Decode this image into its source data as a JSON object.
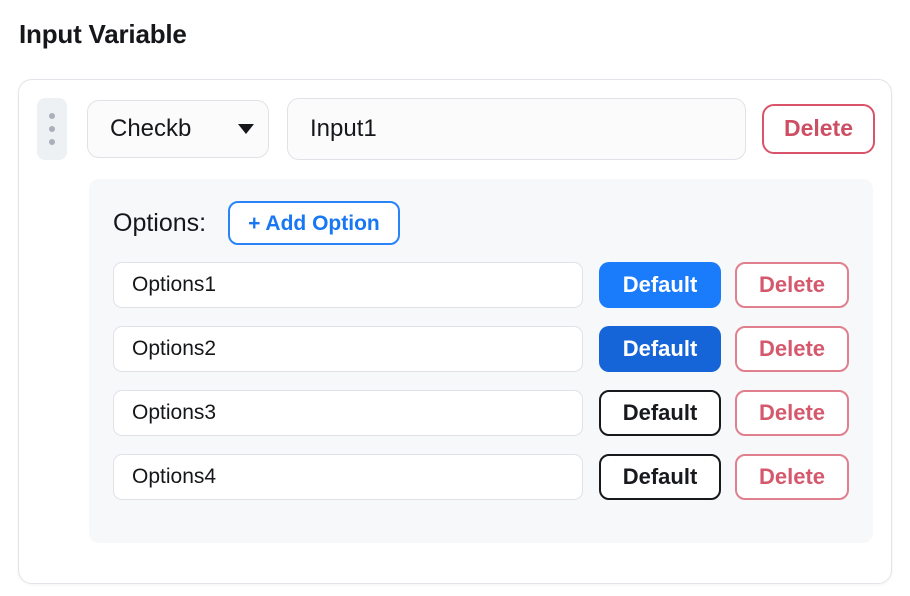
{
  "page": {
    "title": "Input Variable"
  },
  "variable": {
    "drag_handle_icon": "drag-dots-icon",
    "type_select": {
      "value": "Checkb",
      "caret_icon": "chevron-down-icon"
    },
    "name_input": {
      "value": "Input1",
      "placeholder": "Input1"
    },
    "delete_label": "Delete"
  },
  "options_section": {
    "label": "Options:",
    "add_option_label": "+ Add Option",
    "default_label": "Default",
    "delete_label": "Delete",
    "rows": [
      {
        "value": "Options1",
        "placeholder": "Options1",
        "default_label": "Default",
        "delete_label": "Delete",
        "is_default": true,
        "pressed": false
      },
      {
        "value": "Options2",
        "placeholder": "Options2",
        "default_label": "Default",
        "delete_label": "Delete",
        "is_default": true,
        "pressed": true
      },
      {
        "value": "Options3",
        "placeholder": "Options3",
        "default_label": "Default",
        "delete_label": "Delete",
        "is_default": false,
        "pressed": false
      },
      {
        "value": "Options4",
        "placeholder": "Options4",
        "default_label": "Default",
        "delete_label": "Delete",
        "is_default": false,
        "pressed": false
      }
    ]
  },
  "colors": {
    "accent_blue": "#1a7cfa",
    "accent_blue_pressed": "#1565d8",
    "danger_red": "#d4596d",
    "panel_bg": "#f6f8fa",
    "text": "#15171a"
  }
}
